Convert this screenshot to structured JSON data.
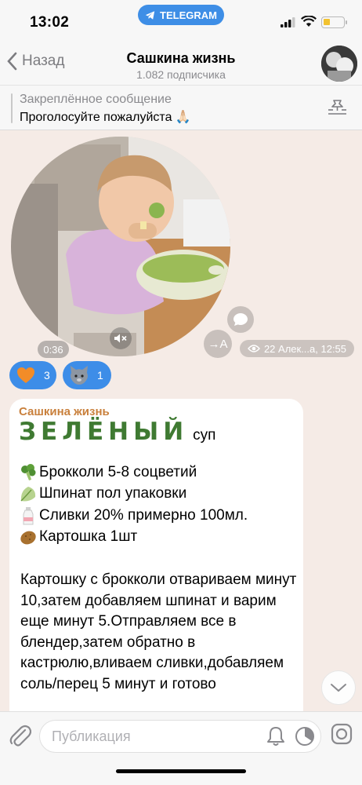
{
  "status_bar": {
    "time": "13:02",
    "telegram_label": "TELEGRAM"
  },
  "header": {
    "back_label": "Назад",
    "title": "Сашкина жизнь",
    "subtitle": "1.082 подписчика"
  },
  "pinned": {
    "title": "Закреплённое сообщение",
    "text": "Проголосуйте пожалуйста 🙏🏻"
  },
  "video": {
    "duration": "0:36",
    "translate_label": "→A",
    "meta": "22 Алек...а, 12:55"
  },
  "reactions": [
    {
      "icon": "heart-icon",
      "count": "3"
    },
    {
      "icon": "cat-face-icon",
      "count": "1"
    }
  ],
  "message": {
    "author": "Сашкина жизнь",
    "headline_word": "ЗЕЛЁНЫЙ",
    "headline_rest": "суп",
    "ingredients": [
      {
        "icon": "broccoli-icon",
        "text": "Брокколи 5-8 соцветий"
      },
      {
        "icon": "leafy-green-icon",
        "text": "Шпинат пол упаковки"
      },
      {
        "icon": "milk-bottle-icon",
        "text": "Сливки 20% примерно 100мл."
      },
      {
        "icon": "potato-icon",
        "text": "Картошка 1шт"
      }
    ],
    "body": "Картошку с брокколи отвариваем минут 10,затем добавляем шпинат и варим еще минут 5.Отправляем все в блендер,затем обратно в кастрюлю,вливаем сливки,добавляем соль/перец 5 минут и готово"
  },
  "composer": {
    "placeholder": "Публикация"
  },
  "colors": {
    "accent": "#3d8de8",
    "author": "#c9803c",
    "headline": "#3f7a32",
    "background": "#f5ebe6"
  }
}
